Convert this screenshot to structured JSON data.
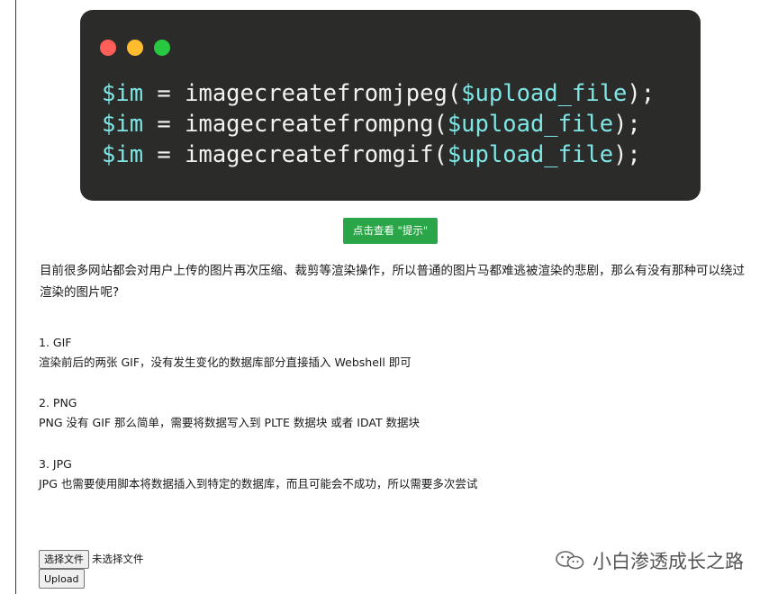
{
  "code": {
    "lines": [
      {
        "var": "$im",
        "op": " = ",
        "func": "imagecreatefromjpeg(",
        "arg": "$upload_file",
        "end": ");"
      },
      {
        "var": "$im",
        "op": " = ",
        "func": "imagecreatefrompng(",
        "arg": "$upload_file",
        "end": ");"
      },
      {
        "var": "$im",
        "op": " = ",
        "func": "imagecreatefromgif(",
        "arg": "$upload_file",
        "end": ");"
      }
    ]
  },
  "hint_button": "点击查看 \"提示\"",
  "intro": "目前很多网站都会对用户上传的图片再次压缩、裁剪等渲染操作，所以普通的图片马都难逃被渲染的悲剧，那么有没有那种可以绕过渲染的图片呢?",
  "sections": [
    {
      "title": "1. GIF",
      "desc": "渲染前后的两张 GIF，没有发生变化的数据库部分直接插入 Webshell 即可"
    },
    {
      "title": "2. PNG",
      "desc": "PNG 没有 GIF 那么简单，需要将数据写入到 PLTE 数据块 或者 IDAT 数据块"
    },
    {
      "title": "3. JPG",
      "desc": "JPG 也需要使用脚本将数据插入到特定的数据库，而且可能会不成功，所以需要多次尝试"
    }
  ],
  "file_input": {
    "button": "选择文件",
    "status": "未选择文件"
  },
  "upload_button": "Upload",
  "watermark": {
    "text": "小白渗透成长之路",
    "icon": "wechat-icon"
  }
}
